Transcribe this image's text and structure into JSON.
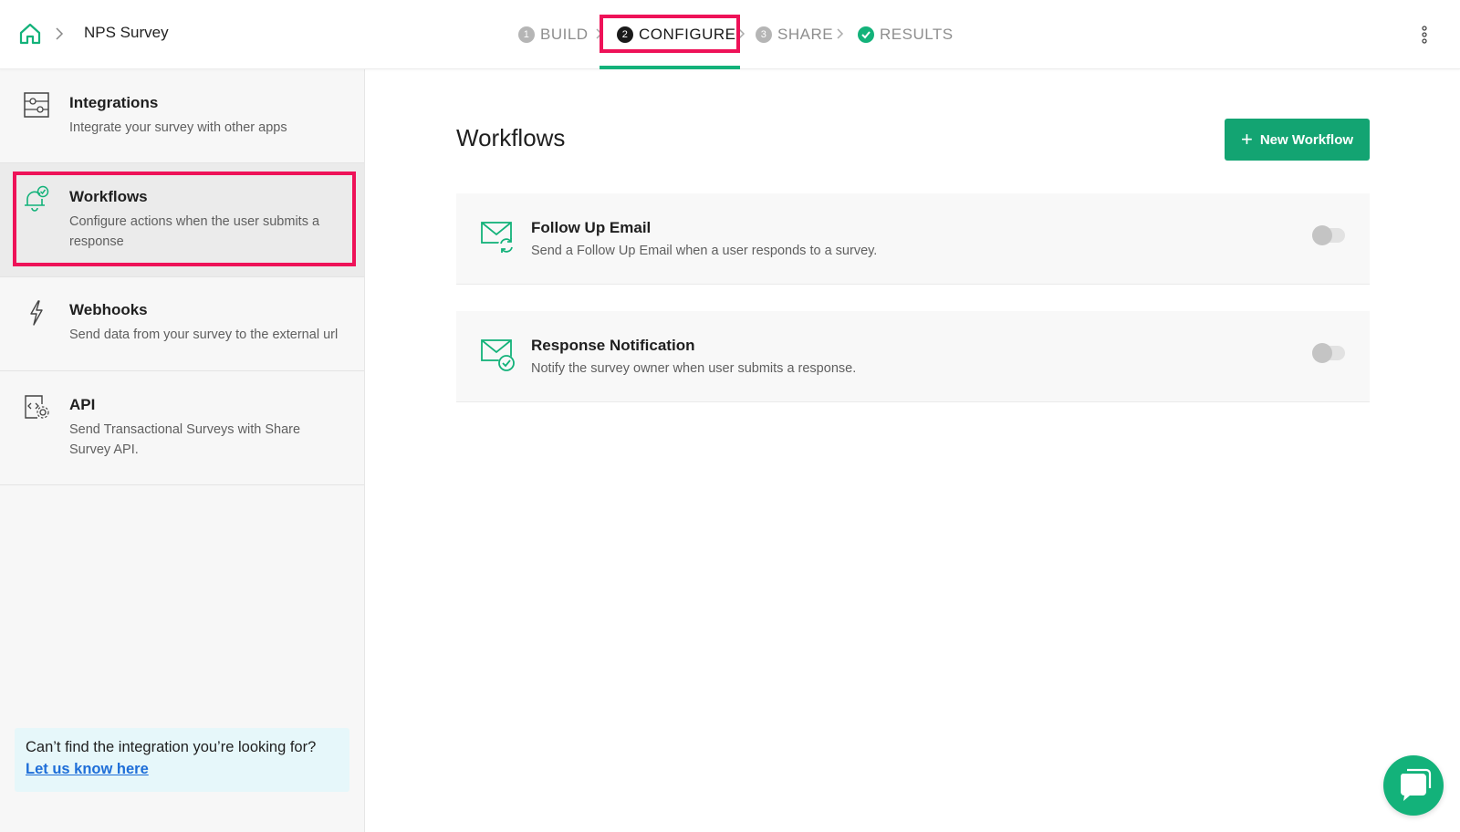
{
  "header": {
    "survey_name": "NPS Survey",
    "steps": [
      {
        "num": "1",
        "label": "BUILD",
        "state": "inactive"
      },
      {
        "num": "2",
        "label": "CONFIGURE",
        "state": "active"
      },
      {
        "num": "3",
        "label": "SHARE",
        "state": "inactive"
      },
      {
        "num": "",
        "label": "RESULTS",
        "state": "complete"
      }
    ]
  },
  "sidebar": {
    "items": [
      {
        "title": "Integrations",
        "description": "Integrate your survey with other apps",
        "icon": "sliders-icon"
      },
      {
        "title": "Workflows",
        "description": "Configure actions when the user submits a response",
        "icon": "bell-check-icon",
        "selected": true
      },
      {
        "title": "Webhooks",
        "description": "Send data from your survey to the external url",
        "icon": "lightning-icon"
      },
      {
        "title": "API",
        "description": "Send Transactional Surveys with Share Survey API.",
        "icon": "code-gear-icon"
      }
    ],
    "help": {
      "text": "Can’t find the integration you’re looking for?",
      "link": "Let us know here"
    }
  },
  "main": {
    "title": "Workflows",
    "new_button": "New Workflow",
    "workflows": [
      {
        "title": "Follow Up Email",
        "description": "Send a Follow Up Email when a user responds to a survey.",
        "icon": "mail-refresh-icon",
        "enabled": false
      },
      {
        "title": "Response Notification",
        "description": "Notify the survey owner when user submits a response.",
        "icon": "mail-check-icon",
        "enabled": false
      }
    ]
  },
  "colors": {
    "accent_green": "#13b27a",
    "button_green": "#13a472",
    "highlight": "#ee1258",
    "link_blue": "#1e6ed8",
    "help_bg": "#e6f7fa"
  }
}
